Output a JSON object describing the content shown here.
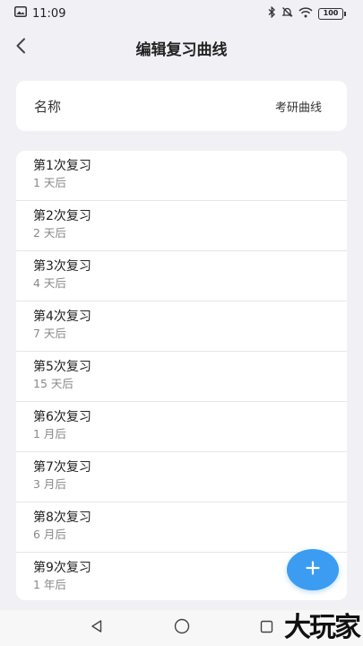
{
  "statusbar": {
    "time": "11:09",
    "battery": "100",
    "icons": [
      "image-icon",
      "bluetooth-icon",
      "mute-icon",
      "wifi-icon",
      "battery-icon"
    ]
  },
  "header": {
    "title": "编辑复习曲线",
    "back_icon": "chevron-left-icon"
  },
  "name_card": {
    "label": "名称",
    "value": "考研曲线"
  },
  "reviews": [
    {
      "title": "第1次复习",
      "interval": "1 天后"
    },
    {
      "title": "第2次复习",
      "interval": "2 天后"
    },
    {
      "title": "第3次复习",
      "interval": "4 天后"
    },
    {
      "title": "第4次复习",
      "interval": "7 天后"
    },
    {
      "title": "第5次复习",
      "interval": "15 天后"
    },
    {
      "title": "第6次复习",
      "interval": "1 月后"
    },
    {
      "title": "第7次复习",
      "interval": "3 月后"
    },
    {
      "title": "第8次复习",
      "interval": "6 月后"
    },
    {
      "title": "第9次复习",
      "interval": "1 年后"
    }
  ],
  "fab": {
    "icon": "plus-icon",
    "color": "#3b9cf2"
  },
  "navbar": {
    "icons": [
      "back-triangle-icon",
      "home-circle-icon",
      "recents-square-icon"
    ]
  },
  "watermark": "大玩家"
}
